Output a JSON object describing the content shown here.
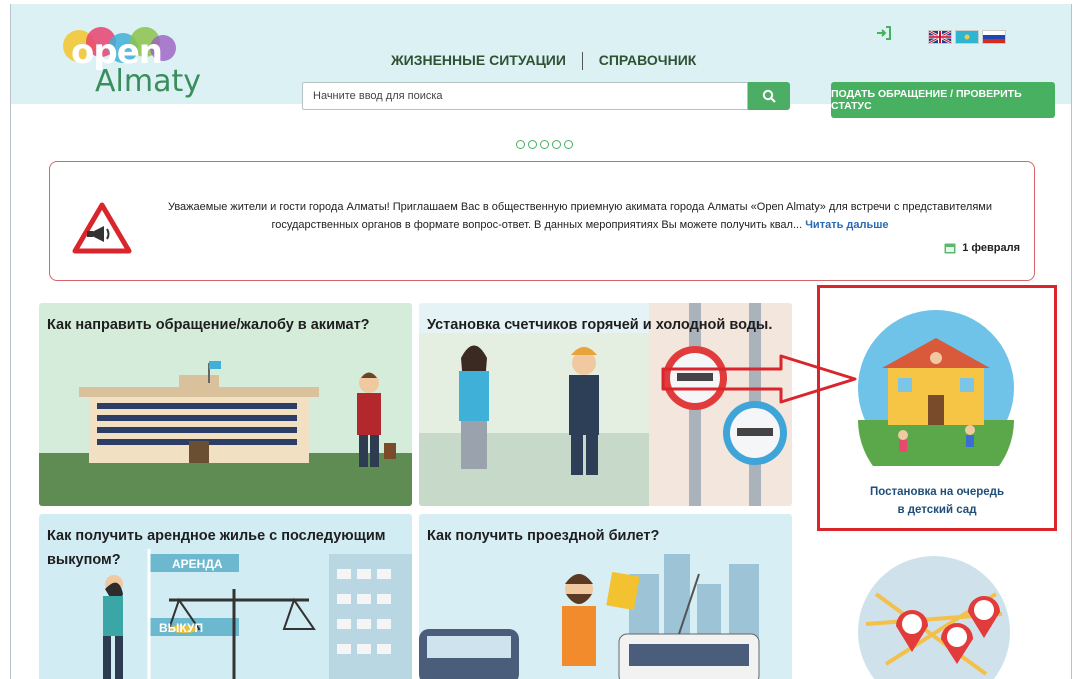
{
  "header": {
    "logo_open": "open",
    "logo_city": "Almaty",
    "nav": [
      "ЖИЗНЕННЫЕ СИТУАЦИИ",
      "СПРАВОЧНИК"
    ],
    "search_placeholder": "Начните ввод для поиска",
    "submit_button": "ПОДАТЬ ОБРАЩЕНИЕ / ПРОВЕРИТЬ СТАТУС"
  },
  "announcement": {
    "line1": "Уважаемые жители и гости города Алматы! Приглашаем Вас в общественную приемную акимата города Алматы «Open Almaty» для встречи с представителями",
    "line2": "государственных органов в формате вопрос-ответ. В данных мероприятиях Вы можете получить квал...",
    "read_more": "Читать дальше",
    "date": "1 февраля"
  },
  "tiles": [
    {
      "title": "Как направить обращение/жалобу в акимат?"
    },
    {
      "title": "Установка счетчиков горячей и холодной воды."
    },
    {
      "title_line1": "Как получить арендное жилье с последующим",
      "title_line2": "выкупом?",
      "sign_top": "АРЕНДА",
      "sign_bottom": "ВЫКУП"
    },
    {
      "title": "Как получить проездной билет?"
    }
  ],
  "kindergarten": {
    "line1": "Постановка на очередь",
    "line2": "в детский сад"
  },
  "colors": {
    "accent_green": "#48b061",
    "highlight_red": "#d8262c",
    "header_bg": "#dcf1f4"
  }
}
